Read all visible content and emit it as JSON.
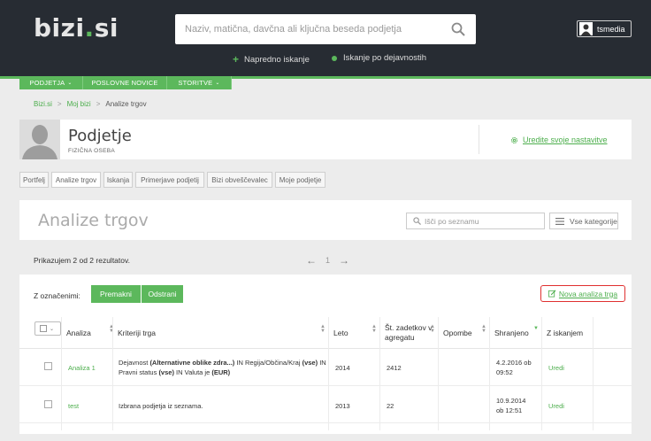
{
  "header": {
    "logo_main": "bizi",
    "logo_dot": ".",
    "logo_tld": "si",
    "search_placeholder": "Naziv, matična, davčna ali ključna beseda podjetja",
    "advanced_search": "Napredno iskanje",
    "activity_search": "Iskanje po dejavnostih",
    "username": "tsmedia"
  },
  "nav": {
    "items": [
      {
        "label": "PODJETJA"
      },
      {
        "label": "POSLOVNE NOVICE"
      },
      {
        "label": "STORITVE"
      }
    ]
  },
  "breadcrumb": {
    "items": [
      "Bizi.si",
      "Moj bizi",
      "Analize trgov"
    ],
    "separator": ">"
  },
  "profile": {
    "name": "Podjetje",
    "type": "FIZIČNA OSEBA",
    "settings_link": "Uredite svoje nastavitve"
  },
  "tabs": [
    {
      "label": "Portfelj"
    },
    {
      "label": "Analize trgov",
      "active": true
    },
    {
      "label": "Iskanja"
    },
    {
      "label": "Primerjave podjetij"
    },
    {
      "label": "Bizi obveščevalec"
    },
    {
      "label": "Moje podjetje"
    }
  ],
  "main": {
    "title": "Analize trgov",
    "list_search_placeholder": "Išči po seznamu",
    "categories_label": "Vse kategorije",
    "result_count": "Prikazujem 2 od 2 rezultatov.",
    "pager": {
      "current": "1"
    }
  },
  "table": {
    "selected_label": "Z označenimi:",
    "move_button": "Premakni",
    "remove_button": "Odstrani",
    "new_analysis": "Nova analiza trga",
    "columns": {
      "analysis": "Analiza",
      "criteria": "Kriteriji trga",
      "year": "Leto",
      "records_l1": "Št. zadetkov v",
      "records_l2": "agregatu",
      "note": "Opombe",
      "saved": "Shranjeno",
      "from_search": "Z iskanjem"
    },
    "rows": [
      {
        "analysis": "Analiza 1",
        "criteria_p1": "Dejavnost ",
        "criteria_b1": "(Alternativne oblike zdra...)",
        "criteria_p2": " IN Regija/Občina/Kraj ",
        "criteria_b2": "(vse)",
        "criteria_p3": " IN",
        "criteria_p4": "Pravni status ",
        "criteria_b3": "(vse)",
        "criteria_p5": " IN Valuta je ",
        "criteria_b4": "(EUR)",
        "year": "2014",
        "records": "2412",
        "saved_l1": "4.2.2016 ob",
        "saved_l2": "09:52",
        "action": "Uredi"
      },
      {
        "analysis": "test",
        "criteria_p1": "Izbrana podjetja iz seznama.",
        "year": "2013",
        "records": "22",
        "saved_l1": "10.9.2014",
        "saved_l2": "ob 12:51",
        "action": "Uredi"
      }
    ]
  },
  "colors": {
    "header_bg": "#272c33",
    "accent_green": "#5cb85c",
    "link_green": "#4cae4c",
    "highlight_red": "#e03030",
    "page_bg": "#ececec"
  },
  "icons": [
    "search-icon",
    "plus-icon",
    "user-avatar-icon",
    "gear-icon",
    "pencil-icon",
    "menu-icon",
    "arrow-left-icon",
    "arrow-right-icon",
    "chevron-down-icon",
    "sort-icon"
  ]
}
